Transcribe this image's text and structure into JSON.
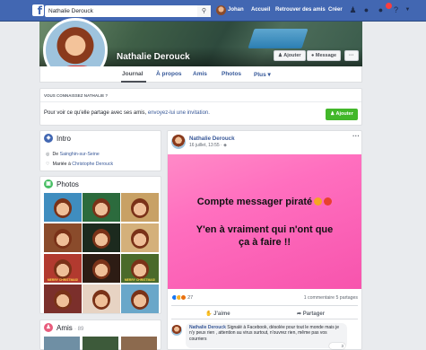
{
  "nav": {
    "search_value": "Nathalie Derouck",
    "user_name": "Johan",
    "home": "Accueil",
    "find_friends": "Retrouver des amis",
    "create": "Créer"
  },
  "profile": {
    "name": "Nathalie Derouck",
    "add_friend": "Ajouter",
    "message": "Message",
    "more_dots": "···"
  },
  "tabs": [
    "Journal",
    "À propos",
    "Amis",
    "Photos",
    "Plus ▾"
  ],
  "know": {
    "heading": "VOUS CONNAISSEZ NATHALIE ?",
    "text_prefix": "Pour voir ce qu'elle partage avec ses amis, ",
    "link": "envoyez-lui une invitation.",
    "button": "Ajouter"
  },
  "intro": {
    "title": "Intro",
    "from_prefix": "De ",
    "from_place": "Sainghin-sur-Seine",
    "married_prefix": "Mariée à ",
    "married_to": "Christophe Derouck"
  },
  "photos": {
    "title": "Photos",
    "captions": [
      "",
      "",
      "",
      "",
      "",
      "",
      "MERRY CHRISTMAS!",
      "",
      "MERRY CHRISTMAS!",
      "",
      "",
      ""
    ]
  },
  "friends": {
    "title": "Amis",
    "count": "· 89"
  },
  "post": {
    "author": "Nathalie Derouck",
    "time": "16 juillet, 13:55 · ",
    "more": "···",
    "line1": "Compte messager piraté",
    "line2a": "Y'en à vraiment qui n'ont que",
    "line2b": "ça à faire !!",
    "reaction_count": "27",
    "counts": "1 commentaire  5 partages",
    "like": "J'aime",
    "share": "Partager",
    "comment_author": "Nathalie Derouck",
    "comment_text": " Signalé à Facebook, désolée pour tout le monde mais je n'y peux rien , attention au virus surtout, n'ouvrez rien, même pas vos courriers",
    "comment_react_count": "3"
  }
}
